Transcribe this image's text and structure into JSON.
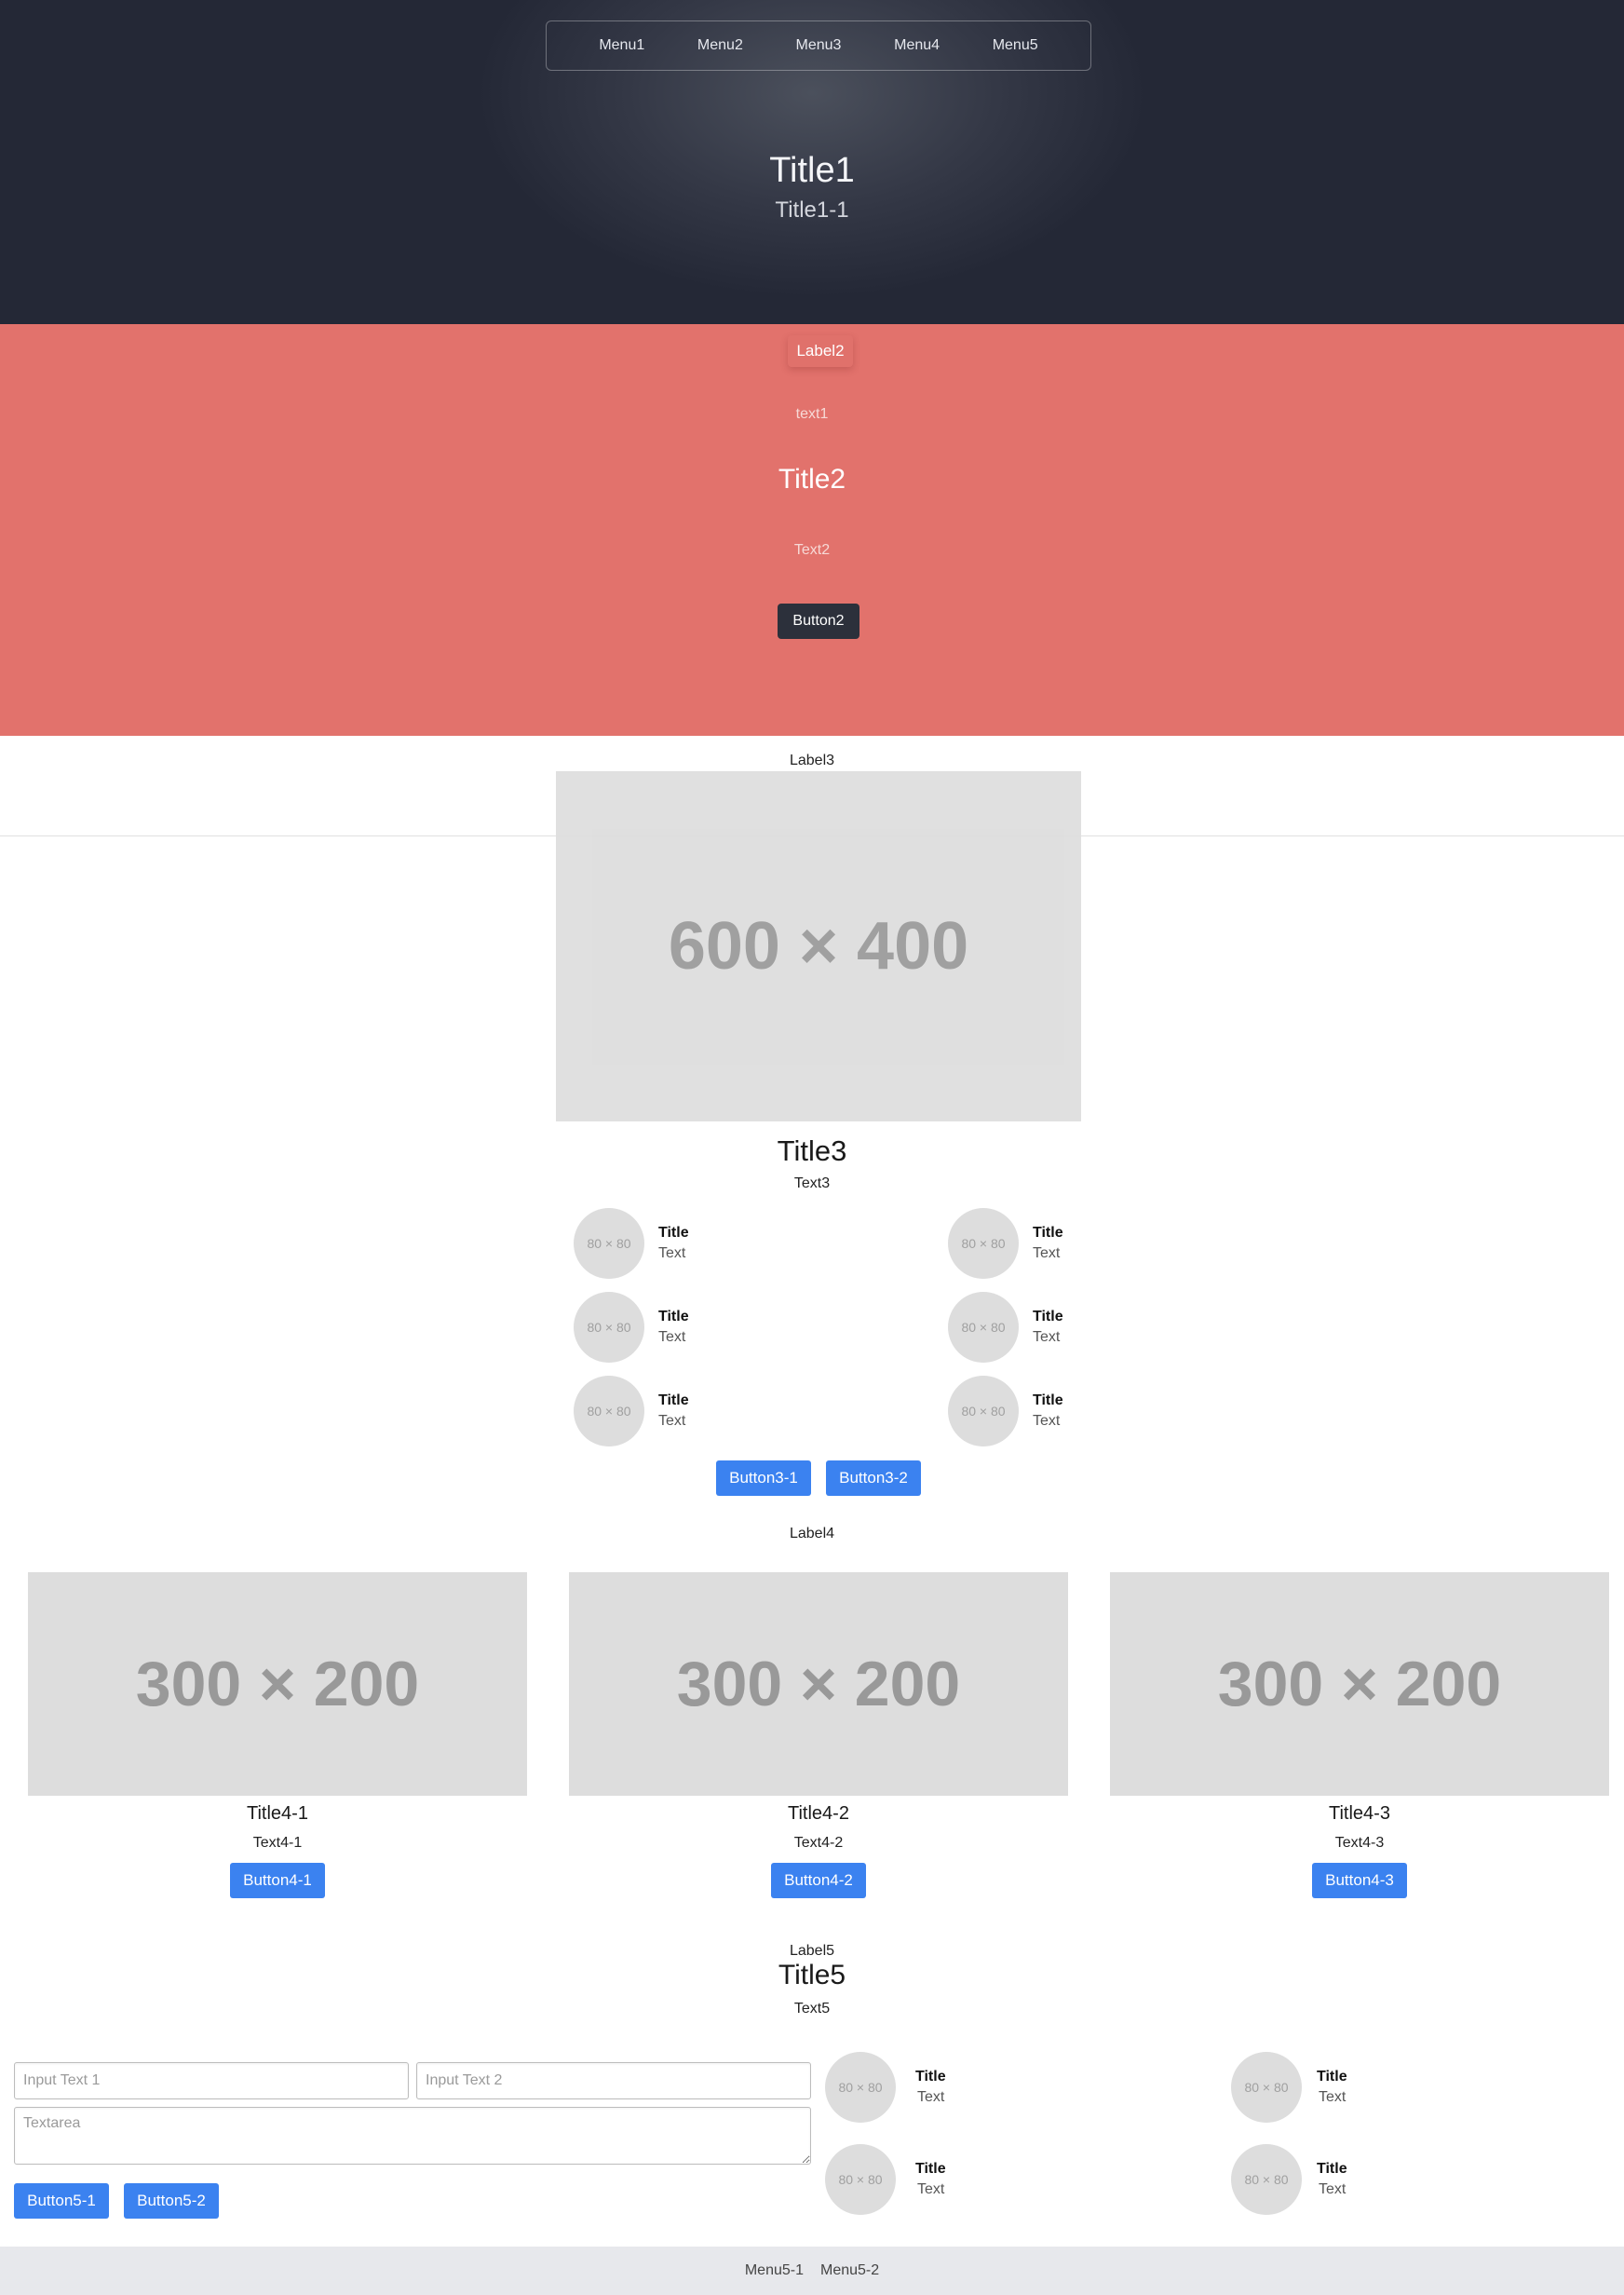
{
  "hero": {
    "menu": [
      "Menu1",
      "Menu2",
      "Menu3",
      "Menu4",
      "Menu5"
    ],
    "title": "Title1",
    "subtitle": "Title1-1"
  },
  "section2": {
    "label": "Label2",
    "text1": "text1",
    "title": "Title2",
    "text2": "Text2",
    "button": "Button2",
    "background_color": "#e2726c"
  },
  "section3": {
    "label": "Label3",
    "image_placeholder": "600 × 400",
    "title": "Title3",
    "text": "Text3",
    "features": [
      {
        "avatar": "80 × 80",
        "title": "Title",
        "text": "Text"
      },
      {
        "avatar": "80 × 80",
        "title": "Title",
        "text": "Text"
      },
      {
        "avatar": "80 × 80",
        "title": "Title",
        "text": "Text"
      },
      {
        "avatar": "80 × 80",
        "title": "Title",
        "text": "Text"
      },
      {
        "avatar": "80 × 80",
        "title": "Title",
        "text": "Text"
      },
      {
        "avatar": "80 × 80",
        "title": "Title",
        "text": "Text"
      }
    ],
    "buttons": [
      "Button3-1",
      "Button3-2"
    ],
    "accent_color": "#3b82f0"
  },
  "section4": {
    "label": "Label4",
    "cards": [
      {
        "image": "300 × 200",
        "title": "Title4-1",
        "text": "Text4-1",
        "button": "Button4-1"
      },
      {
        "image": "300 × 200",
        "title": "Title4-2",
        "text": "Text4-2",
        "button": "Button4-2"
      },
      {
        "image": "300 × 200",
        "title": "Title4-3",
        "text": "Text4-3",
        "button": "Button4-3"
      }
    ]
  },
  "section5": {
    "label": "Label5",
    "title": "Title5",
    "text": "Text5",
    "input1_placeholder": "Input Text 1",
    "input2_placeholder": "Input Text 2",
    "textarea_placeholder": "Textarea",
    "buttons": [
      "Button5-1",
      "Button5-2"
    ],
    "features": [
      {
        "avatar": "80 × 80",
        "title": "Title",
        "text": "Text"
      },
      {
        "avatar": "80 × 80",
        "title": "Title",
        "text": "Text"
      },
      {
        "avatar": "80 × 80",
        "title": "Title",
        "text": "Text"
      },
      {
        "avatar": "80 × 80",
        "title": "Title",
        "text": "Text"
      }
    ]
  },
  "footer": {
    "links": [
      "Menu5-1",
      "Menu5-2"
    ]
  }
}
